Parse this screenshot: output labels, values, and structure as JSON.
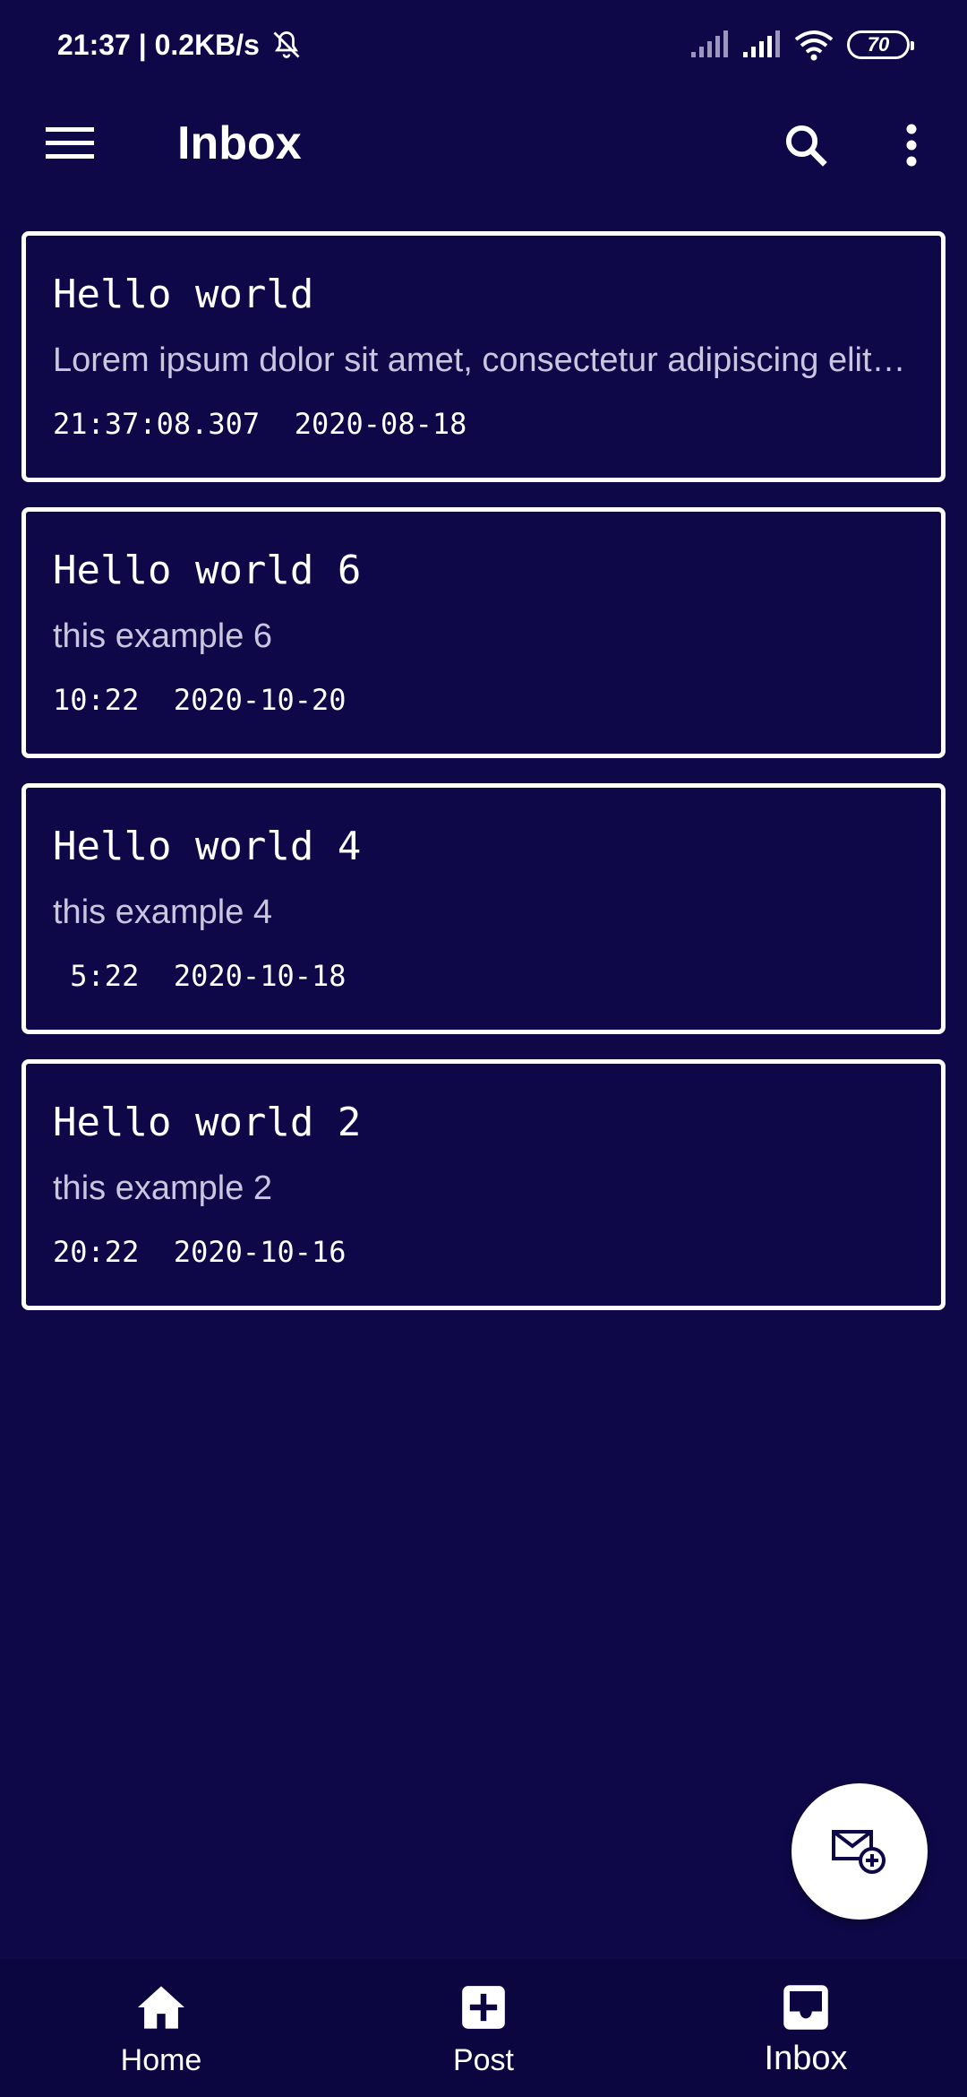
{
  "status_bar": {
    "time_speed": "21:37 | 0.2KB/s",
    "battery": "70"
  },
  "app_bar": {
    "title": "Inbox"
  },
  "messages": [
    {
      "title": "Hello world",
      "body": "Lorem ipsum dolor sit amet, consectetur adipiscing elit. …",
      "meta": "21:37:08.307  2020-08-18"
    },
    {
      "title": "Hello world 6",
      "body": "this example 6",
      "meta": "10:22  2020-10-20"
    },
    {
      "title": "Hello world 4",
      "body": "this example 4",
      "meta": " 5:22  2020-10-18"
    },
    {
      "title": "Hello world 2",
      "body": "this example 2",
      "meta": "20:22  2020-10-16"
    }
  ],
  "bottom_nav": {
    "items": [
      {
        "label": "Home",
        "icon": "home-icon"
      },
      {
        "label": "Post",
        "icon": "add-box-icon"
      },
      {
        "label": "Inbox",
        "icon": "inbox-icon",
        "active": true
      }
    ]
  },
  "fab": {
    "icon": "compose-mail-icon"
  },
  "colors": {
    "background": "#0e0848",
    "nav_background": "#0b0640",
    "text": "#ffffff",
    "muted_text": "#c9c6e0",
    "fab": "#ffffff"
  }
}
